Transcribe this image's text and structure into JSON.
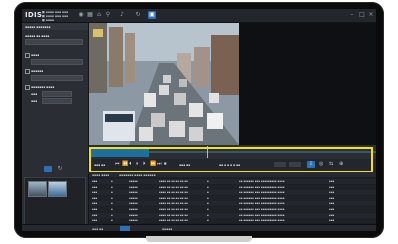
{
  "app": {
    "logo": "IDIS"
  },
  "topbar": {
    "status_lines": [
      "■ ▪▪▪▪ ▪▪▪ ▪▪▪",
      "■ ▪▪▪▪ ▪▪▪ ▪▪▪",
      "■ ▪▪▪▪"
    ],
    "icons": [
      "home-icon",
      "search-icon",
      "refresh-icon",
      "settings-icon",
      "monitor-icon"
    ]
  },
  "left_panel": {
    "header": "▪▪▪▪▪ ▪▪▪▪▪▪▪",
    "search_label": "▪▪▪▪▪ ▪▪ ▪▪▪▪",
    "option_labels": [
      "▪▪▪▪",
      "▪▪▪▪▪▪",
      "▪▪▪▪▪▪▪ ▪▪▪▪"
    ],
    "field_labels": [
      "▪▪▪",
      "▪▪▪"
    ]
  },
  "controls": {
    "time_labels": [
      "▪▪▪ ▪▪",
      "▪▪▪ ▪▪"
    ],
    "speed": "▪▪ ▪ ▪ ▪ ▪ ▪▪",
    "glyphs": [
      "⏮",
      "⏪",
      "⏴",
      "⏸",
      "⏵",
      "⏩",
      "⏭",
      "⏹"
    ]
  },
  "events_bar": {
    "tabs": [
      "▪▪▪▪ ▪▪▪▪",
      "▪▪▪▪▪▪▪ ▪▪▪▪ ▪▪▪▪▪▪"
    ]
  },
  "events": [
    [
      "▪▪▪",
      "▪",
      "▪▪▪▪▪",
      "▪▪▪▪ ▪▪ ▪▪ ▪▪:▪▪:▪▪",
      "▪",
      "▪▪ ▪▪▪▪▪▪ ▪▪▪ ▪▪▪▪▪▪▪▪▪ ▪▪▪▪",
      "▪▪▪"
    ],
    [
      "▪▪▪",
      "▪",
      "▪▪▪▪▪",
      "▪▪▪▪ ▪▪ ▪▪ ▪▪:▪▪:▪▪",
      "▪",
      "▪▪ ▪▪▪▪▪▪ ▪▪▪ ▪▪▪▪▪▪▪▪▪ ▪▪▪▪",
      "▪▪▪"
    ],
    [
      "▪▪▪",
      "▪",
      "▪▪▪▪▪",
      "▪▪▪▪ ▪▪ ▪▪ ▪▪:▪▪:▪▪",
      "▪",
      "▪▪ ▪▪▪▪▪▪ ▪▪▪ ▪▪▪▪▪▪▪▪▪ ▪▪▪▪",
      "▪▪▪"
    ],
    [
      "▪▪▪",
      "▪",
      "▪▪▪▪▪",
      "▪▪▪▪ ▪▪ ▪▪ ▪▪:▪▪:▪▪",
      "▪",
      "▪▪ ▪▪▪▪▪▪ ▪▪▪ ▪▪▪▪▪▪▪▪▪ ▪▪▪▪",
      "▪▪▪"
    ],
    [
      "▪▪▪",
      "▪",
      "▪▪▪▪▪",
      "▪▪▪▪ ▪▪ ▪▪ ▪▪:▪▪:▪▪",
      "▪",
      "▪▪ ▪▪▪▪▪▪ ▪▪▪ ▪▪▪▪▪▪▪▪▪ ▪▪▪▪",
      "▪▪▪"
    ],
    [
      "▪▪▪",
      "▪",
      "▪▪▪▪▪",
      "▪▪▪▪ ▪▪ ▪▪ ▪▪:▪▪:▪▪",
      "▪",
      "▪▪ ▪▪▪▪▪▪ ▪▪▪ ▪▪▪▪▪▪▪▪▪ ▪▪▪▪",
      "▪▪▪"
    ],
    [
      "▪▪▪",
      "▪",
      "▪▪▪▪▪",
      "▪▪▪▪ ▪▪ ▪▪ ▪▪:▪▪:▪▪",
      "▪",
      "▪▪ ▪▪▪▪▪▪ ▪▪▪ ▪▪▪▪▪▪▪▪▪ ▪▪▪▪",
      "▪▪▪"
    ],
    [
      "▪▪▪",
      "▪",
      "▪▪▪▪▪",
      "▪▪▪▪ ▪▪ ▪▪ ▪▪:▪▪:▪▪",
      "▪",
      "▪▪ ▪▪▪▪▪▪ ▪▪▪ ▪▪▪▪▪▪▪▪▪ ▪▪▪▪",
      "▪▪▪"
    ]
  ],
  "statusbar": {
    "left": "▪▪▪ ▪▪",
    "center": "▪▪▪▪▪"
  },
  "colors": {
    "accent": "#2f6fb8",
    "highlight": "#f2e21a",
    "background": "#1d1f23"
  }
}
